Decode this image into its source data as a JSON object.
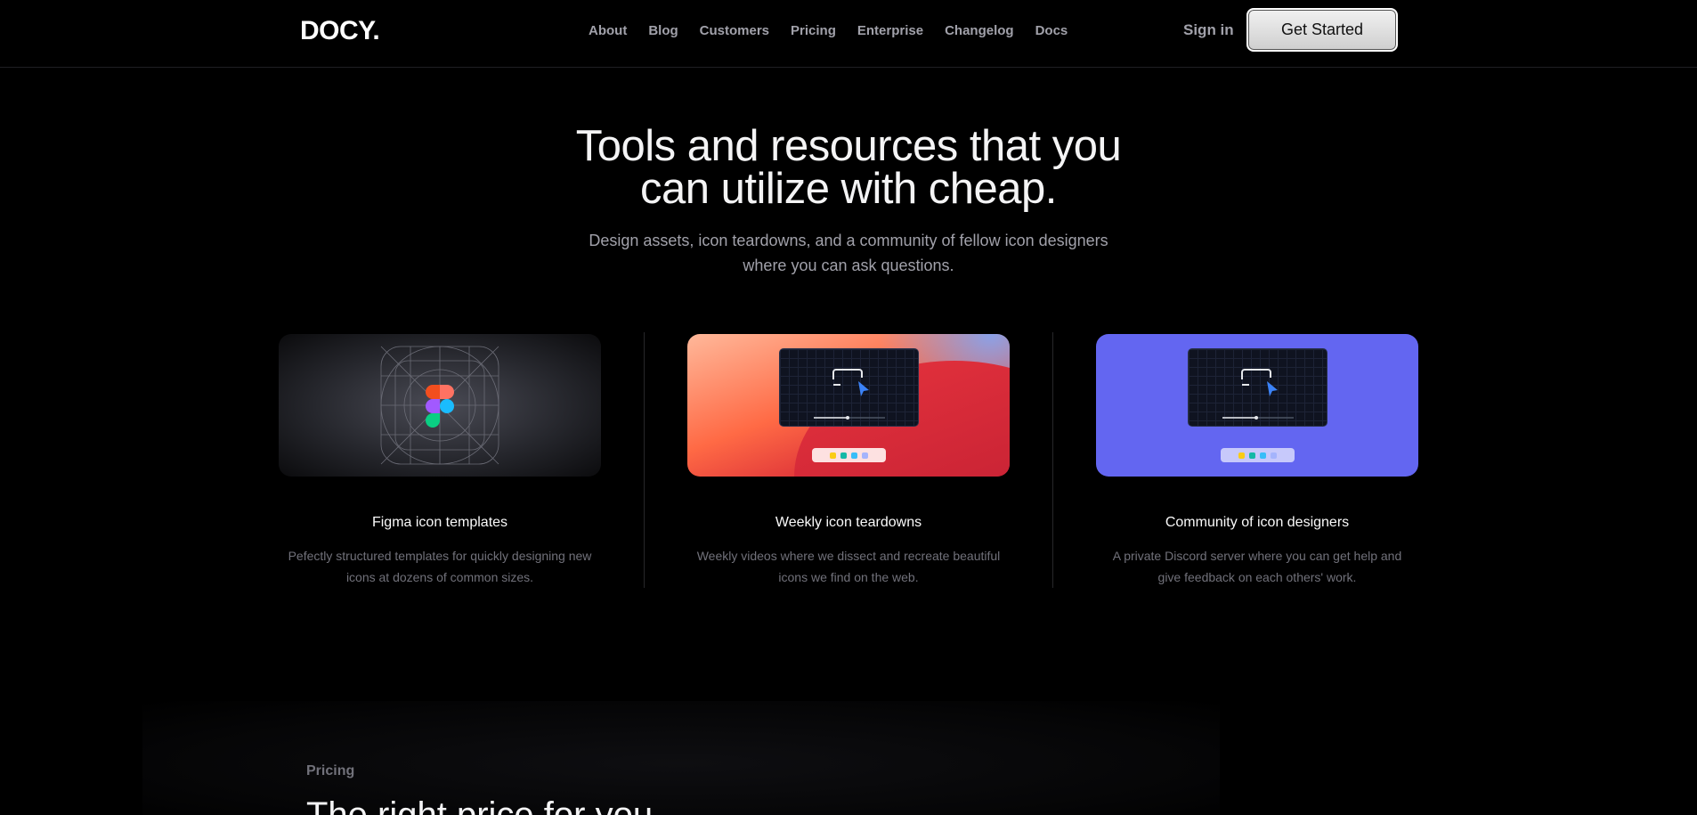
{
  "nav": {
    "logo": "DOCY.",
    "links": [
      "About",
      "Blog",
      "Customers",
      "Pricing",
      "Enterprise",
      "Changelog",
      "Docs"
    ],
    "signin": "Sign in",
    "cta": "Get Started"
  },
  "hero": {
    "title_line1": "Tools and resources that you",
    "title_line2": "can utilize with cheap.",
    "subtitle_line1": "Design assets, icon teardowns, and a community of fellow icon designers",
    "subtitle_line2": "where you can ask questions."
  },
  "cards": [
    {
      "title": "Figma icon templates",
      "desc_line1": "Pefectly structured templates for quickly designing new",
      "desc_line2": "icons at dozens of common sizes."
    },
    {
      "title": "Weekly icon teardowns",
      "desc_line1": "Weekly videos where we dissect and recreate beautiful",
      "desc_line2": "icons we find on the web."
    },
    {
      "title": "Community of icon designers",
      "desc_line1": "A private Discord server where you can get help and",
      "desc_line2": "give feedback on each others' work."
    }
  ],
  "pricing": {
    "label": "Pricing",
    "title": "The right price for you"
  },
  "colors": {
    "accent": "#6366f1",
    "background": "#000000",
    "figma_red": "#f24e1e",
    "figma_orange": "#ff7262",
    "figma_purple": "#a259ff",
    "figma_blue": "#1abcfe",
    "figma_green": "#0acf83"
  }
}
